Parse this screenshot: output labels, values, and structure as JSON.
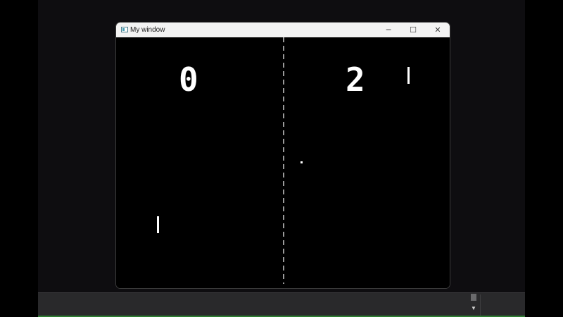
{
  "window": {
    "title": "My window",
    "minimize_symbol": "─",
    "maximize_symbol": "☐",
    "close_symbol": "✕"
  },
  "game": {
    "score_left": "0",
    "score_right": "2"
  },
  "taskbar": {
    "scroll_arrow": "▼"
  },
  "colors": {
    "game_background": "#000000",
    "game_foreground": "#ffffff",
    "titlebar": "#f3f3f3",
    "desktop": "#0e0d10",
    "bottom_panel": "#29292b",
    "accent_line": "#2e7d32"
  },
  "icons": [
    "app-window-icon",
    "minimize-icon",
    "maximize-icon",
    "close-icon",
    "scroll-down-arrow-icon"
  ]
}
